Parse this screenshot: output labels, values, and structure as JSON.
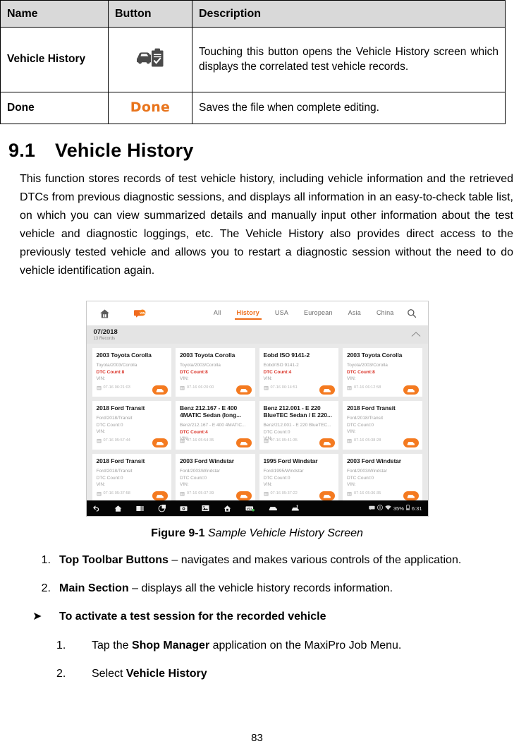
{
  "table": {
    "headers": [
      "Name",
      "Button",
      "Description"
    ],
    "rows": [
      {
        "name": "Vehicle History",
        "button_icon": "vehicle-history-icon",
        "button_label": "",
        "description": "Touching this button opens the Vehicle History screen which displays the correlated test vehicle records."
      },
      {
        "name": "Done",
        "button_icon": "",
        "button_label": "Done",
        "description": "Saves the file when complete editing."
      }
    ]
  },
  "section": {
    "number": "9.1",
    "title": "Vehicle History",
    "paragraph": "This function stores records of test vehicle history, including vehicle information and the retrieved DTCs from previous diagnostic sessions, and displays all information in an easy-to-check table list, on which you can view summarized details and manually input other information about the test vehicle and diagnostic loggings, etc. The Vehicle History also provides direct access to the previously tested vehicle and allows you to restart a diagnostic session without the need to do vehicle identification again."
  },
  "figure": {
    "caption_bold": "Figure 9-1",
    "caption_italic": "Sample Vehicle History Screen"
  },
  "device": {
    "toolbar": {
      "home_icon": "home-icon",
      "vin_icon": "vin-scan-icon",
      "search_icon": "search-icon",
      "tabs": [
        {
          "label": "All",
          "active": false
        },
        {
          "label": "History",
          "active": true
        },
        {
          "label": "USA",
          "active": false
        },
        {
          "label": "European",
          "active": false
        },
        {
          "label": "Asia",
          "active": false
        },
        {
          "label": "China",
          "active": false
        }
      ]
    },
    "date_group": {
      "date": "07/2018",
      "records": "13 Records",
      "collapse_icon": "chevron-up-icon"
    },
    "cards": [
      {
        "title": "2003 Toyota Corolla",
        "detail": "Toyota/2003/Corolla",
        "dtc": "DTC Count:8",
        "vin": "VIN:",
        "timestamp": "07-16 06:21:03"
      },
      {
        "title": "2003 Toyota Corolla",
        "detail": "Toyota/2003/Corolla",
        "dtc": "DTC Count:8",
        "vin": "VIN:",
        "timestamp": "07-16 06:20:00"
      },
      {
        "title": "Eobd ISO 9141-2",
        "detail": "Eobd/ISO 9141-2",
        "dtc": "DTC Count:4",
        "vin": "VIN:",
        "timestamp": "07-16 06:14:51"
      },
      {
        "title": "2003 Toyota Corolla",
        "detail": "Toyota/2003/Corolla",
        "dtc": "DTC Count:8",
        "vin": "VIN:",
        "timestamp": "07-16 06:12:58"
      },
      {
        "title": "2018 Ford Transit",
        "detail": "Ford/2018/Transit",
        "dtc": "DTC Count:0",
        "vin": "VIN:",
        "timestamp": "07-16 05:57:44"
      },
      {
        "title": "Benz 212.167 - E 400 4MATIC Sedan (long...",
        "detail": "Benz/212.167 - E 400 4MATIC...",
        "dtc": "DTC Count:4",
        "vin": "VIN:",
        "timestamp": "07-16 05:54:35"
      },
      {
        "title": "Benz 212.001 - E 220 BlueTEC Sedan / E 220...",
        "detail": "Benz/212.001 - E 220 BlueTEC...",
        "dtc": "DTC Count:0",
        "vin": "VIN:",
        "timestamp": "07-16 05:41:35"
      },
      {
        "title": "2018 Ford Transit",
        "detail": "Ford/2018/Transit",
        "dtc": "DTC Count:0",
        "vin": "VIN:",
        "timestamp": "07-16 05:38:28"
      },
      {
        "title": "2018 Ford Transit",
        "detail": "Ford/2018/Transit",
        "dtc": "DTC Count:0",
        "vin": "VIN:",
        "timestamp": "07-16 05:37:58"
      },
      {
        "title": "2003 Ford Windstar",
        "detail": "Ford/2003/Windstar",
        "dtc": "DTC Count:0",
        "vin": "VIN:",
        "timestamp": "07-16 05:37:39"
      },
      {
        "title": "1995 Ford Windstar",
        "detail": "Ford/1995/Windstar",
        "dtc": "DTC Count:0",
        "vin": "VIN:",
        "timestamp": "07-16 05:37:22"
      },
      {
        "title": "2003 Ford Windstar",
        "detail": "Ford/2003/Windstar",
        "dtc": "DTC Count:0",
        "vin": "VIN:",
        "timestamp": "07-16 05:36:35"
      }
    ],
    "navbar": {
      "icons": [
        "back-icon",
        "home-icon",
        "recent-apps-icon",
        "vci-connect-icon",
        "camera-icon",
        "screenshot-icon",
        "shop-icon",
        "vci-manager-icon",
        "vehicle-icon",
        "data-logging-icon"
      ],
      "status": {
        "message_icon": "message-icon",
        "info_icon": "info-icon",
        "wifi_icon": "wifi-icon",
        "battery_level": "35%",
        "battery_icon": "battery-icon",
        "time": "6:31"
      }
    },
    "accent_color": "#f47a20",
    "dtc_color": "#d93025"
  },
  "list": {
    "items": [
      {
        "marker": "1.",
        "bold": "Top Toolbar Buttons",
        "rest": " – navigates and makes various controls of the application."
      },
      {
        "marker": "2.",
        "bold": "Main Section",
        "rest": " – displays all the vehicle history records information."
      }
    ],
    "bullet": {
      "marker": "➤",
      "text": "To activate a test session for the recorded vehicle"
    },
    "steps": [
      {
        "marker": "1.",
        "pre": "Tap the ",
        "bold": "Shop Manager",
        "post": " application on the MaxiPro Job Menu."
      },
      {
        "marker": "2.",
        "pre": "Select ",
        "bold": "Vehicle History",
        "post": ""
      }
    ]
  },
  "page_number": "83"
}
